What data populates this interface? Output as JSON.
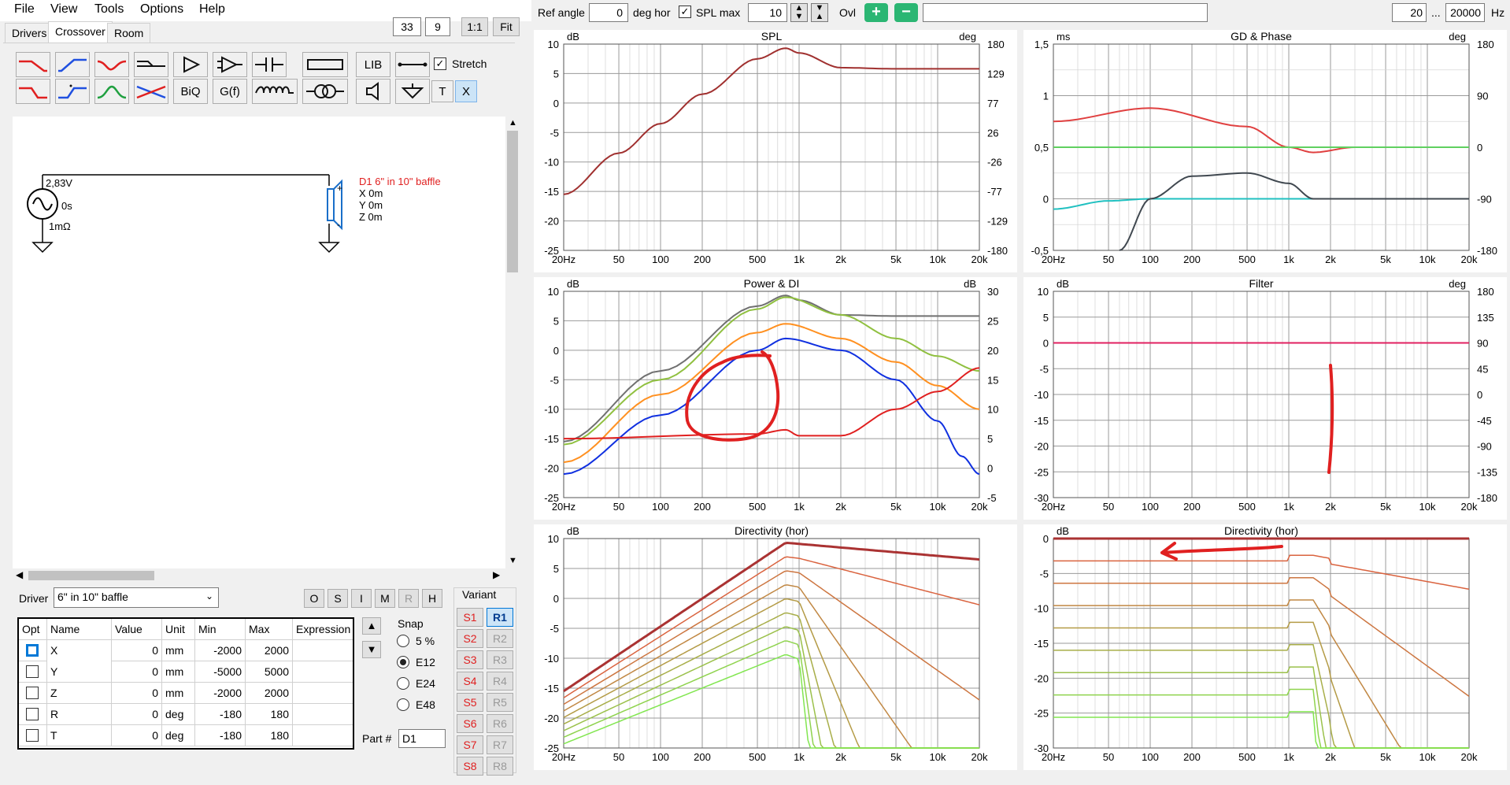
{
  "menu": [
    "File",
    "View",
    "Tools",
    "Options",
    "Help"
  ],
  "top_left": {
    "box1": "33",
    "box2": "9",
    "btn_1to1": "1:1",
    "btn_fit": "Fit"
  },
  "tabs": [
    "Drivers",
    "Crossover",
    "Room"
  ],
  "toolbar": {
    "lib": "LIB",
    "biq": "BiQ",
    "gf": "G(f)",
    "t": "T",
    "x": "X",
    "stretch": "Stretch"
  },
  "schematic": {
    "source_voltage": "2,83V",
    "source_delay": "0s",
    "source_res": "1mΩ",
    "driver_name": "D1 6\" in 10\" baffle",
    "driver_x": "X 0m",
    "driver_y": "Y 0m",
    "driver_z": "Z 0m",
    "plus": "+",
    "minus": "-"
  },
  "driver_panel": {
    "label": "Driver",
    "selected": "6\" in 10\" baffle",
    "buttons": [
      "O",
      "S",
      "I",
      "M",
      "R",
      "H"
    ]
  },
  "param_table": {
    "headers": [
      "Opt",
      "Name",
      "Value",
      "Unit",
      "Min",
      "Max",
      "Expression"
    ],
    "rows": [
      {
        "name": "X",
        "value": "0",
        "unit": "mm",
        "min": "-2000",
        "max": "2000"
      },
      {
        "name": "Y",
        "value": "0",
        "unit": "mm",
        "min": "-5000",
        "max": "5000"
      },
      {
        "name": "Z",
        "value": "0",
        "unit": "mm",
        "min": "-2000",
        "max": "2000"
      },
      {
        "name": "R",
        "value": "0",
        "unit": "deg",
        "min": "-180",
        "max": "180"
      },
      {
        "name": "T",
        "value": "0",
        "unit": "deg",
        "min": "-180",
        "max": "180"
      }
    ]
  },
  "snap": {
    "label": "Snap",
    "options": [
      "5 %",
      "E12",
      "E24",
      "E48"
    ],
    "selected": 1
  },
  "part": {
    "label": "Part #",
    "value": "D1"
  },
  "variant": {
    "label": "Variant",
    "s": [
      "S1",
      "S2",
      "S3",
      "S4",
      "S5",
      "S6",
      "S7",
      "S8"
    ],
    "r": [
      "R1",
      "R2",
      "R3",
      "R4",
      "R5",
      "R6",
      "R7",
      "R8"
    ]
  },
  "top_bar": {
    "ref_angle_label": "Ref angle",
    "ref_angle": "0",
    "deg_hor": "deg hor",
    "spl_max_label": "SPL max",
    "spl_max": "10",
    "ovl": "Ovl",
    "f_min": "20",
    "dots": "...",
    "f_max": "20000",
    "hz": "Hz"
  },
  "x_ticks": [
    "20Hz",
    "50",
    "100",
    "200",
    "500",
    "1k",
    "2k",
    "5k",
    "10k",
    "20k"
  ],
  "charts": {
    "spl": {
      "title": "SPL",
      "left_unit": "dB",
      "right_unit": "deg",
      "left_ticks": [
        "10",
        "5",
        "0",
        "-5",
        "-10",
        "-15",
        "-20",
        "-25"
      ],
      "right_ticks": [
        "180",
        "129",
        "77",
        "26",
        "-26",
        "-77",
        "-129",
        "-180"
      ]
    },
    "gd": {
      "title": "GD & Phase",
      "left_unit": "ms",
      "right_unit": "deg",
      "left_ticks": [
        "1,5",
        "1",
        "0,5",
        "0",
        "-0,5"
      ],
      "right_ticks": [
        "180",
        "90",
        "0",
        "-90",
        "-180"
      ]
    },
    "power": {
      "title": "Power & DI",
      "left_unit": "dB",
      "right_unit": "dB",
      "left_ticks": [
        "10",
        "5",
        "0",
        "-5",
        "-10",
        "-15",
        "-20",
        "-25"
      ],
      "right_ticks": [
        "30",
        "25",
        "20",
        "15",
        "10",
        "5",
        "0",
        "-5"
      ]
    },
    "filter": {
      "title": "Filter",
      "left_unit": "dB",
      "right_unit": "deg",
      "left_ticks": [
        "10",
        "5",
        "0",
        "-5",
        "-10",
        "-15",
        "-20",
        "-25",
        "-30"
      ],
      "right_ticks": [
        "180",
        "135",
        "90",
        "45",
        "0",
        "-45",
        "-90",
        "-135",
        "-180"
      ]
    },
    "dir1": {
      "title": "Directivity (hor)",
      "left_unit": "dB",
      "right_unit": "",
      "left_ticks": [
        "10",
        "5",
        "0",
        "-5",
        "-10",
        "-15",
        "-20",
        "-25"
      ],
      "right_ticks": []
    },
    "dir2": {
      "title": "Directivity (hor)",
      "left_unit": "dB",
      "right_unit": "",
      "left_ticks": [
        "0",
        "-5",
        "-10",
        "-15",
        "-20",
        "-25",
        "-30"
      ],
      "right_ticks": []
    }
  },
  "chart_data": [
    {
      "type": "line",
      "title": "SPL",
      "ylabel": "dB",
      "ylim": [
        -25,
        10
      ],
      "xscale": "log",
      "xlim": [
        20,
        20000
      ],
      "series": [
        {
          "x": [
            20,
            50,
            100,
            200,
            500,
            800,
            1000,
            2000,
            5000,
            20000
          ],
          "values": [
            -15.5,
            -8.5,
            -3.5,
            1.5,
            7.5,
            9.3,
            8.5,
            6,
            5.8,
            5.8
          ],
          "color": "#a0302f"
        }
      ]
    },
    {
      "type": "line",
      "title": "GD & Phase",
      "ylabel": "ms",
      "ylim": [
        -0.5,
        1.5
      ],
      "xscale": "log",
      "xlim": [
        20,
        20000
      ],
      "series": [
        {
          "x": [
            20,
            100,
            500,
            1000,
            1500,
            3000,
            20000
          ],
          "values": [
            0.75,
            0.88,
            0.7,
            0.5,
            0.45,
            0.5,
            0.5
          ],
          "color": "#e04040"
        },
        {
          "x": [
            20,
            20000
          ],
          "values": [
            0.5,
            0.5
          ],
          "color": "#60d060"
        },
        {
          "x": [
            20,
            50,
            100,
            1000,
            20000
          ],
          "values": [
            -0.1,
            -0.02,
            0,
            0,
            0
          ],
          "color": "#20c0c0"
        },
        {
          "x": [
            60,
            100,
            200,
            500,
            1000,
            1500,
            3000,
            20000
          ],
          "values": [
            -0.5,
            0,
            0.22,
            0.25,
            0.15,
            0,
            0,
            0
          ],
          "color": "#404850"
        }
      ]
    },
    {
      "type": "line",
      "title": "Power & DI",
      "ylabel": "dB",
      "ylim": [
        -25,
        10
      ],
      "xscale": "log",
      "xlim": [
        20,
        20000
      ],
      "series": [
        {
          "x": [
            20,
            100,
            500,
            800,
            1000,
            2000,
            5000,
            20000
          ],
          "values": [
            -15.5,
            -3.5,
            7.5,
            9.3,
            8.5,
            6,
            5.8,
            5.8
          ],
          "color": "#707070"
        },
        {
          "x": [
            20,
            100,
            500,
            800,
            2000,
            5000,
            10000,
            20000
          ],
          "values": [
            -16,
            -5,
            7,
            9,
            6,
            2,
            -1,
            -3.5
          ],
          "color": "#90c040"
        },
        {
          "x": [
            20,
            100,
            500,
            800,
            2000,
            5000,
            10000,
            20000
          ],
          "values": [
            -19,
            -7.5,
            3,
            4.5,
            2,
            -2,
            -6,
            -10
          ],
          "color": "#ff9020"
        },
        {
          "x": [
            20,
            100,
            500,
            800,
            2000,
            5000,
            10000,
            15000,
            20000
          ],
          "values": [
            -21,
            -11,
            0,
            2,
            0,
            -5,
            -12,
            -18,
            -21
          ],
          "color": "#1030e0"
        },
        {
          "x": [
            20,
            500,
            800,
            1000,
            2000,
            5000,
            10000,
            20000
          ],
          "values": [
            -15,
            -14.2,
            -13.5,
            -14.5,
            -14.5,
            -10,
            -7,
            -3
          ],
          "color": "#e02020"
        }
      ]
    },
    {
      "type": "line",
      "title": "Filter",
      "ylabel": "dB",
      "ylim": [
        -30,
        10
      ],
      "xscale": "log",
      "xlim": [
        20,
        20000
      ],
      "series": [
        {
          "x": [
            20,
            20000
          ],
          "values": [
            0,
            0
          ],
          "color": "#e02060"
        }
      ]
    },
    {
      "type": "line",
      "title": "Directivity (hor)",
      "ylabel": "dB",
      "ylim": [
        -25,
        10
      ],
      "xscale": "log",
      "xlim": [
        20,
        20000
      ]
    },
    {
      "type": "line",
      "title": "Directivity (hor)",
      "ylabel": "dB",
      "ylim": [
        -30,
        0
      ],
      "xscale": "log",
      "xlim": [
        20,
        20000
      ]
    }
  ]
}
